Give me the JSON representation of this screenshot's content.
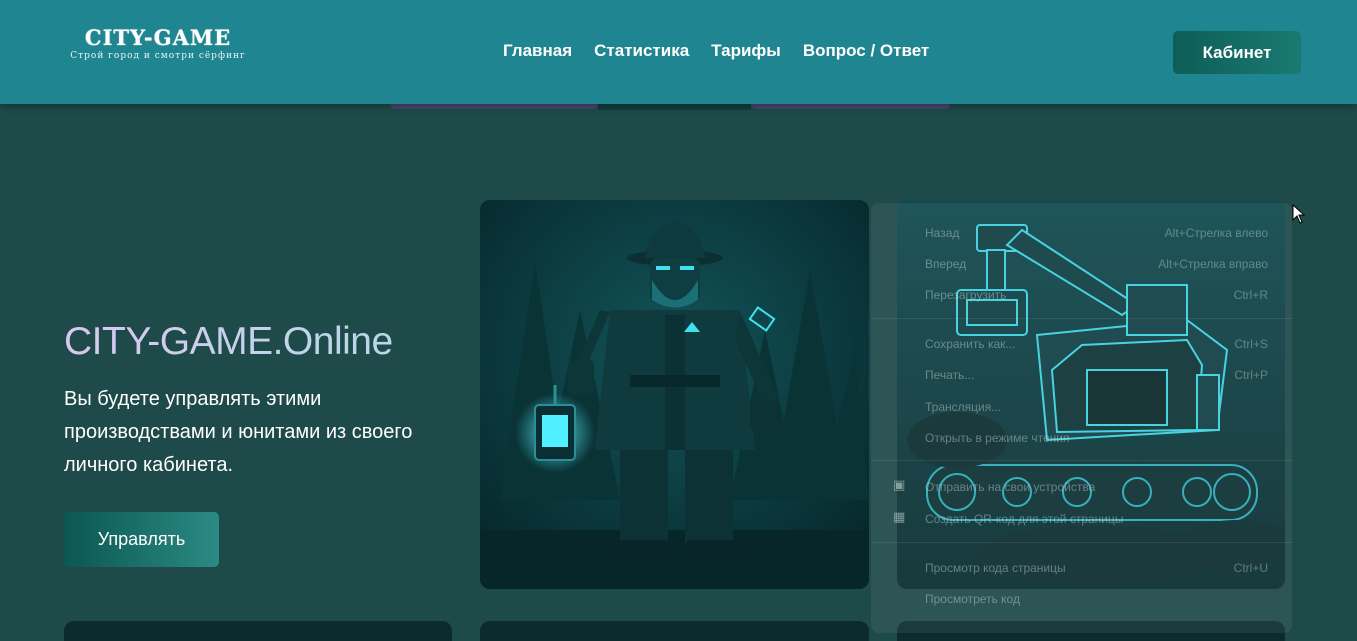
{
  "header": {
    "logo_title": "CITY-GAME",
    "logo_subtitle": "Строй город и смотри сёрфинг",
    "nav": [
      "Главная",
      "Статистика",
      "Тарифы",
      "Вопрос / Ответ"
    ],
    "cabinet_label": "Кабинет"
  },
  "hero": {
    "title": "CITY-GAME.Online",
    "text": "Вы будете управлять этими производствами и юнитами из своего личного кабинета.",
    "button": "Управлять"
  },
  "cards": [
    {
      "icon": "ranger-lantern-illustration"
    },
    {
      "icon": "mining-excavator-illustration"
    }
  ],
  "context_menu": {
    "items": [
      {
        "label": "Назад",
        "shortcut": "Alt+Стрелка влево"
      },
      {
        "label": "Вперед",
        "shortcut": "Alt+Стрелка вправо"
      },
      {
        "label": "Перезагрузить",
        "shortcut": "Ctrl+R"
      },
      {
        "label": "Сохранить как...",
        "shortcut": "Ctrl+S"
      },
      {
        "label": "Печать...",
        "shortcut": "Ctrl+P"
      },
      {
        "label": "Трансляция...",
        "shortcut": ""
      },
      {
        "label": "Открыть в режиме чтения",
        "shortcut": ""
      },
      {
        "label": "Отправить на свои устройства",
        "shortcut": ""
      },
      {
        "label": "Создать QR-код для этой страницы",
        "shortcut": ""
      },
      {
        "label": "Просмотр кода страницы",
        "shortcut": "Ctrl+U"
      },
      {
        "label": "Просмотреть код",
        "shortcut": ""
      }
    ]
  },
  "colors": {
    "header_bg": "#1f8590",
    "page_bg": "#1f4a4a",
    "button_gradient_start": "#0c5752",
    "accent_cyan": "#3fe0f0"
  }
}
